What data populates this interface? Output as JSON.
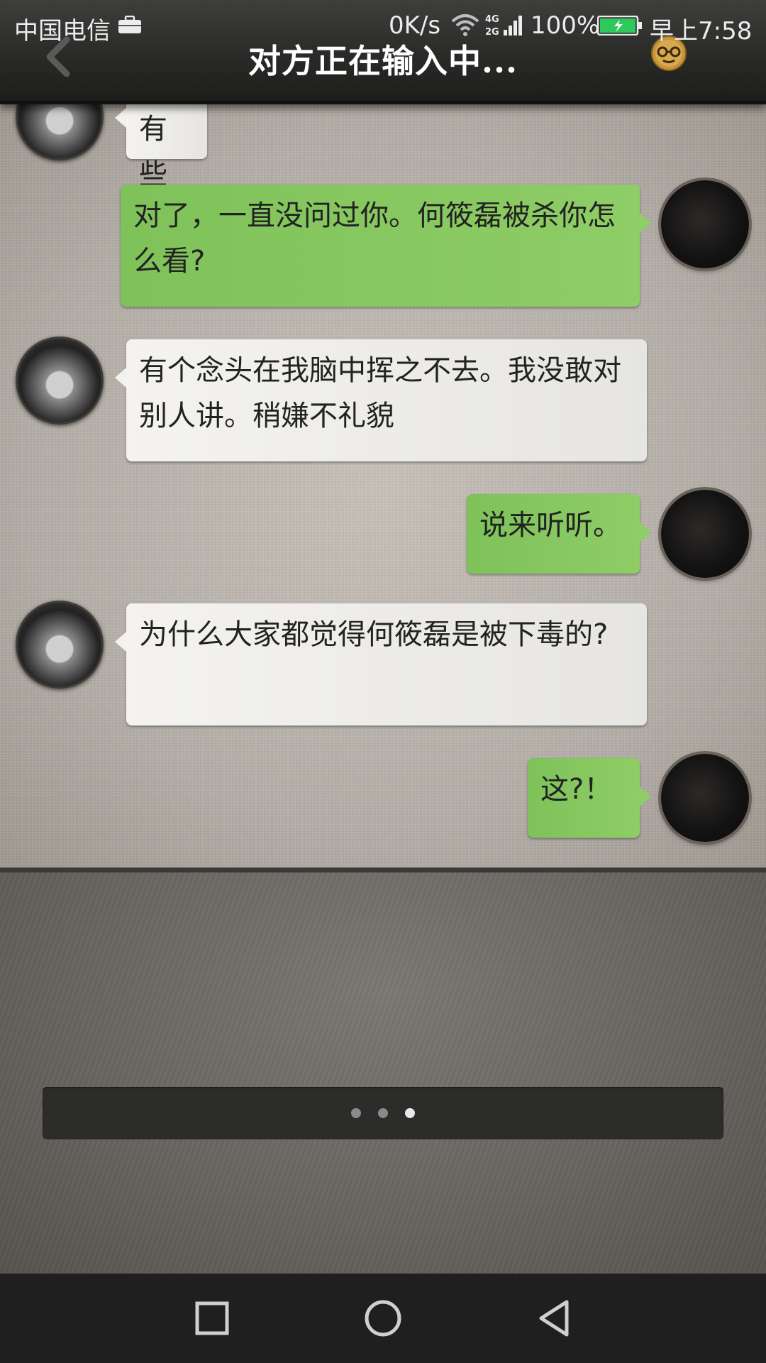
{
  "status_bar": {
    "carrier": "中国电信",
    "net_speed": "0K/s",
    "network_type": "4G 2G",
    "battery": "100%",
    "time": "早上7:58"
  },
  "header": {
    "title": "对方正在输入中..."
  },
  "messages": [
    {
      "from": "her",
      "text": "有些"
    },
    {
      "from": "me",
      "text": "对了，一直没问过你。何筱磊被杀你怎么看?"
    },
    {
      "from": "her",
      "text": "有个念头在我脑中挥之不去。我没敢对别人讲。稍嫌不礼貌"
    },
    {
      "from": "me",
      "text": "说来听听。"
    },
    {
      "from": "her",
      "text": "为什么大家都觉得何筱磊是被下毒的?"
    },
    {
      "from": "me",
      "text": "这?！"
    }
  ],
  "pager": {
    "page_count": 3,
    "active_page": 3
  },
  "icons": {
    "back": "chevron-left-icon",
    "profile": "emoji-glasses-icon",
    "nav_recent": "square-icon",
    "nav_home": "circle-icon",
    "nav_back": "triangle-back-icon"
  },
  "colors": {
    "outgoing_bubble": "#88c860",
    "incoming_bubble": "#eeede9",
    "header": "#2a2a28"
  }
}
